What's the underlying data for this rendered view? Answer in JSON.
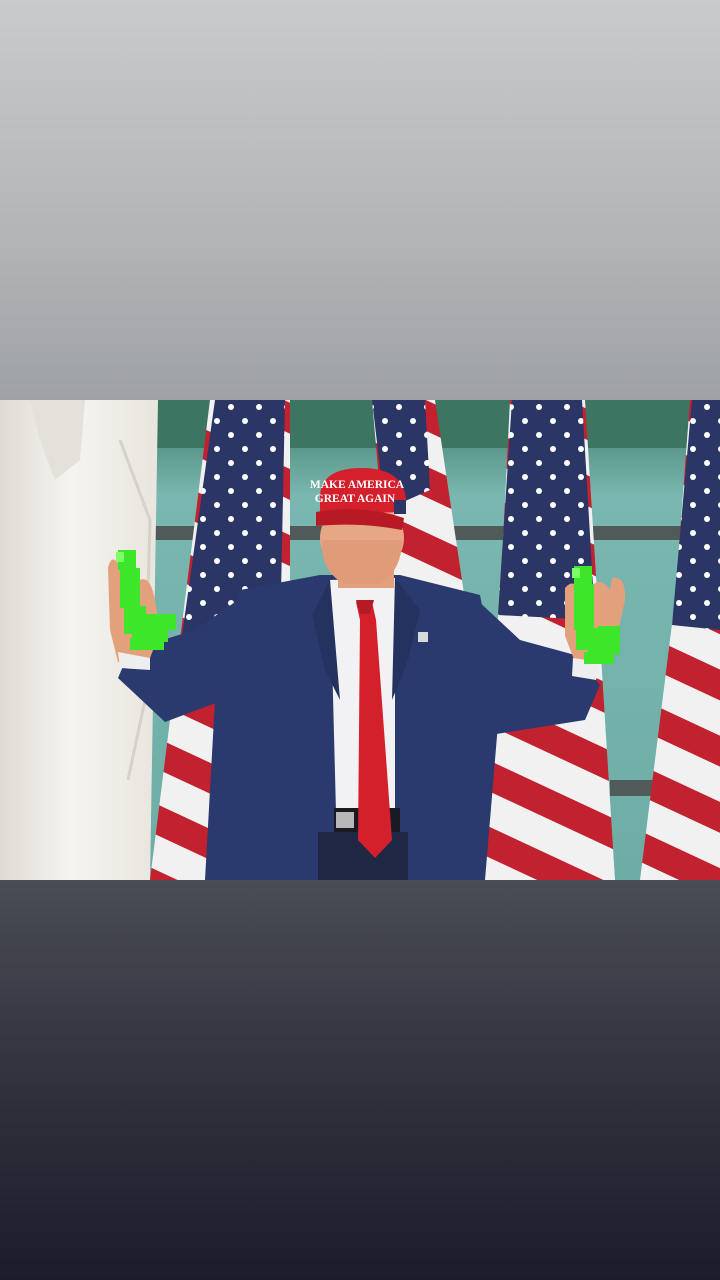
{
  "story": {
    "top_band_color": "#b4b6b8",
    "bottom_band_color": "#262635"
  },
  "photo": {
    "subject": "man in navy suit and red tie with raised hands in front of american flags",
    "hat": {
      "line1": "MAKE AMERICA",
      "line2": "GREAT AGAIN",
      "color": "#d41f2c"
    },
    "overlay_icon": "green-pixel-sticker-icon",
    "colors": {
      "suit": "#2a3a6e",
      "tie": "#d4202a",
      "sticker": "#3ee62a",
      "building": "#5f9a8c",
      "flag_blue": "#2b3566",
      "flag_red": "#c2212f"
    }
  }
}
